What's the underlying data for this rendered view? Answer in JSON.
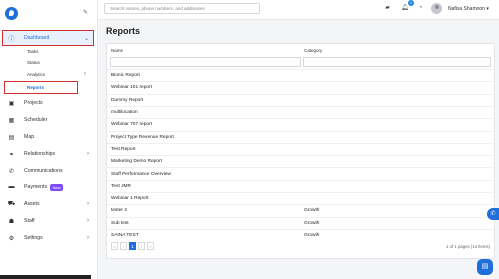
{
  "search": {
    "placeholder": "Search names, phone numbers, and addresses"
  },
  "user": {
    "name": "Nafisa Shamoon ▾",
    "notif_count": "1"
  },
  "sidebar": {
    "items": [
      {
        "label": "Dashboard",
        "icon": "info-icon"
      },
      {
        "label": "Projects",
        "icon": "briefcase-icon"
      },
      {
        "label": "Scheduler",
        "icon": "calendar-icon"
      },
      {
        "label": "Map",
        "icon": "map-icon"
      },
      {
        "label": "Relationships",
        "icon": "handshake-icon"
      },
      {
        "label": "Communications",
        "icon": "phone-icon"
      },
      {
        "label": "Payments",
        "icon": "wallet-icon",
        "badge": "New"
      },
      {
        "label": "Assets",
        "icon": "truck-icon"
      },
      {
        "label": "Staff",
        "icon": "users-icon"
      },
      {
        "label": "Settings",
        "icon": "gear-icon"
      }
    ],
    "sub": {
      "tasks": "Tasks",
      "status": "Status",
      "analytics": "Analytics",
      "reports": "Reports"
    }
  },
  "page": {
    "title": "Reports"
  },
  "table": {
    "headers": [
      "Name",
      "Category"
    ],
    "rows": [
      [
        "Bionic Report",
        ""
      ],
      [
        "Webinar 101 report",
        ""
      ],
      [
        "Dummy Report",
        ""
      ],
      [
        "multilocation",
        ""
      ],
      [
        "Webinar 707 report",
        ""
      ],
      [
        "Project Type Revenue Report",
        ""
      ],
      [
        "Test Report",
        ""
      ],
      [
        "Marketing Demo Report",
        ""
      ],
      [
        "Staff Performance Overview",
        ""
      ],
      [
        "Test JMR",
        ""
      ],
      [
        "Webinar 1 Report",
        ""
      ],
      [
        "tester 2",
        "Growth"
      ],
      [
        "Sub test",
        "Growth"
      ],
      [
        "SAINA TEST",
        "Growth"
      ]
    ]
  },
  "pager": {
    "first": "«",
    "prev": "‹",
    "page": "1",
    "next": "›",
    "last": "»",
    "info": "1 of 1 pages (14 items)"
  },
  "colors": {
    "accent": "#1e6fd9",
    "highlight": "#d32f2f",
    "badge": "#7b4dff"
  }
}
